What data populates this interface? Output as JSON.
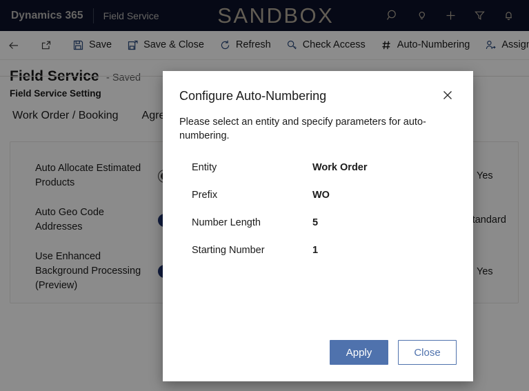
{
  "topbar": {
    "brand": "Dynamics 365",
    "app_name": "Field Service",
    "environment_banner": "SANDBOX",
    "icons": [
      {
        "name": "search-icon",
        "label": "Search"
      },
      {
        "name": "lightbulb-icon",
        "label": "Assistant"
      },
      {
        "name": "plus-icon",
        "label": "Quick create"
      },
      {
        "name": "filter-icon",
        "label": "Filter"
      },
      {
        "name": "bell-icon",
        "label": "Notifications"
      }
    ]
  },
  "commandbar": {
    "back_label": "Back",
    "popout_label": "Open in new window",
    "save_label": "Save",
    "save_close_label": "Save & Close",
    "refresh_label": "Refresh",
    "check_access_label": "Check Access",
    "auto_numbering_label": "Auto-Numbering",
    "assign_label": "Assign"
  },
  "page": {
    "title": "Field Service",
    "status": "- Saved",
    "subtitle": "Field Service Setting",
    "tabs": [
      {
        "label": "Work Order / Booking",
        "active": true
      },
      {
        "label": "Agreement",
        "active": false
      }
    ]
  },
  "settings": [
    {
      "label": "Auto Allocate Estimated Products",
      "toggle_state": "off",
      "value": "Yes"
    },
    {
      "label": "Auto Geo Code Addresses",
      "toggle_state": "on",
      "value": "/Standard"
    },
    {
      "label": "Use Enhanced Background Processing (Preview)",
      "toggle_state": "on",
      "value": "Yes"
    }
  ],
  "dialog": {
    "title": "Configure Auto-Numbering",
    "close_label": "Close dialog",
    "description": "Please select an entity and specify parameters for auto-numbering.",
    "fields": [
      {
        "label": "Entity",
        "value": "Work Order"
      },
      {
        "label": "Prefix",
        "value": "WO"
      },
      {
        "label": "Number Length",
        "value": "5"
      },
      {
        "label": "Starting Number",
        "value": "1"
      }
    ],
    "apply_label": "Apply",
    "close_button_label": "Close"
  },
  "colors": {
    "topbar_bg": "#0b1228",
    "sandbox_text": "#b3a99a",
    "primary_button": "#4f72ad",
    "toggle_on": "#1f3470",
    "command_icon": "#2b4a7d"
  }
}
